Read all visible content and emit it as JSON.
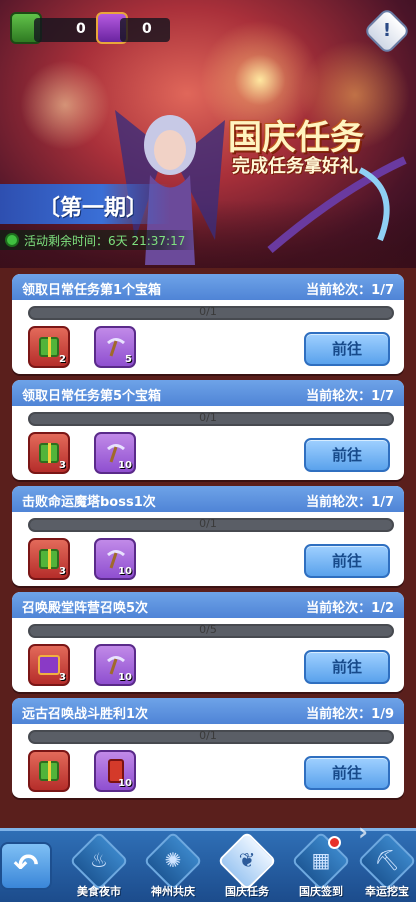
{
  "header": {
    "resource1_count": "0",
    "resource2_count": "0",
    "info_label": "!",
    "title": "国庆任务",
    "subtitle": "完成任务拿好礼",
    "issue": "〔第一期〕",
    "timer": "活动剩余时间：6天 21:37:17"
  },
  "tasks": [
    {
      "title": "领取日常任务第1个宝箱",
      "round": "当前轮次：1/7",
      "progress": "0/1",
      "item1_count": "2",
      "item2_count": "5",
      "button": "前往"
    },
    {
      "title": "领取日常任务第5个宝箱",
      "round": "当前轮次：1/7",
      "progress": "0/1",
      "item1_count": "3",
      "item2_count": "10",
      "button": "前往"
    },
    {
      "title": "击败命运魔塔boss1次",
      "round": "当前轮次：1/7",
      "progress": "0/1",
      "item1_count": "3",
      "item2_count": "10",
      "button": "前往"
    },
    {
      "title": "召唤殿堂阵营召唤5次",
      "round": "当前轮次：1/2",
      "progress": "0/5",
      "item1_count": "3",
      "item2_count": "10",
      "button": "前往"
    },
    {
      "title": "远古召唤战斗胜利1次",
      "round": "当前轮次：1/9",
      "progress": "0/1",
      "item1_count": "",
      "item2_count": "10",
      "button": "前往"
    }
  ],
  "nav": {
    "back_label": "↶",
    "tabs": [
      "美食夜市",
      "神州共庆",
      "国庆任务",
      "国庆签到",
      "幸运挖宝"
    ],
    "active_tab": "国庆任务"
  }
}
